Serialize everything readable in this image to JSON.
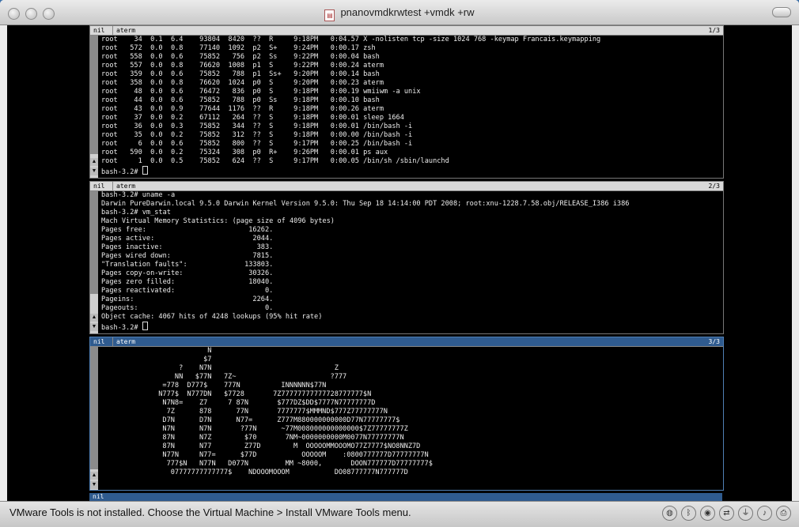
{
  "window": {
    "title": "pnanovmdkrwtest +vmdk +rw"
  },
  "panes": [
    {
      "tab1": "nil",
      "tab2": "aterm",
      "index": "1/3",
      "lines": [
        "root    34  0.1  6.4    93804  8420  ??  R     9:18PM   0:04.57 X -nolisten tcp -size 1024 768 -keymap Francais.keymapping",
        "root   572  0.0  0.8    77140  1092  p2  S+    9:24PM   0:00.17 zsh",
        "root   558  0.0  0.6    75852   756  p2  Ss    9:22PM   0:00.04 bash",
        "root   557  0.0  0.8    76620  1008  p1  S     9:22PM   0:00.24 aterm",
        "root   359  0.0  0.6    75852   788  p1  Ss+   9:20PM   0:00.14 bash",
        "root   358  0.0  0.8    76620  1024  p0  S     9:20PM   0:00.23 aterm",
        "root    48  0.0  0.6    76472   836  p0  S     9:18PM   0:00.19 wmiiwm -a unix",
        "root    44  0.0  0.6    75852   788  p0  Ss    9:18PM   0:00.10 bash",
        "root    43  0.0  0.9    77644  1176  ??  R     9:18PM   0:00.26 aterm",
        "root    37  0.0  0.2    67112   264  ??  S     9:18PM   0:00.01 sleep 1664",
        "root    36  0.0  0.3    75852   344  ??  S     9:18PM   0:00.01 /bin/bash -i",
        "root    35  0.0  0.2    75852   312  ??  S     9:18PM   0:00.00 /bin/bash -i",
        "root     6  0.0  0.6    75852   800  ??  S     9:17PM   0:00.25 /bin/bash -i",
        "root   590  0.0  0.2    75324   308  p0  R+    9:26PM   0:00.01 ps aux",
        "root     1  0.0  0.5    75852   624  ??  S     9:17PM   0:00.05 /bin/sh /sbin/launchd"
      ],
      "prompt": "bash-3.2# "
    },
    {
      "tab1": "nil",
      "tab2": "aterm",
      "index": "2/3",
      "lines": [
        "bash-3.2# uname -a",
        "Darwin PureDarwin.local 9.5.0 Darwin Kernel Version 9.5.0: Thu Sep 18 14:14:00 PDT 2008; root:xnu-1228.7.58.obj/RELEASE_I386 i386",
        "bash-3.2# vm_stat",
        "Mach Virtual Memory Statistics: (page size of 4096 bytes)",
        "Pages free:                         16262.",
        "Pages active:                        2044.",
        "Pages inactive:                       383.",
        "Pages wired down:                    7815.",
        "\"Translation faults\":              133803.",
        "Pages copy-on-write:                30326.",
        "Pages zero filled:                  18040.",
        "Pages reactivated:                      0.",
        "Pageins:                             2264.",
        "Pageouts:                               0.",
        "Object cache: 4067 hits of 4248 lookups (95% hit rate)"
      ],
      "prompt": "bash-3.2# "
    },
    {
      "tab1": "nil",
      "tab2": "aterm",
      "index": "3/3",
      "art": [
        "                   N",
        "                  $7",
        "            ?    N7N                              Z",
        "           NN   $77N   7Z~                       ?777",
        "        =778  D777$    777N          INNNNNN$77N",
        "       N777$  N777DN   $7728       7Z77777777777728777777$N",
        "        N7N8=    Z7     7 87N       $777DZ$DD$7777N77777777D",
        "         7Z      878      77N       7777777$MMMND$777Z77777777N",
        "        D7N      D7N      N77=      Z777M880000000000D77N77777777$",
        "        N7N      N7N       ?77N      ~77M008000000000000$7Z77777777Z",
        "        87N      N7Z        $70       7NM~0000000000M0077N77777777N",
        "        87N      N77        Z77D        M  OOOOOMMOOOMO77Z7777$NO8NNZ7D",
        "        N77N     N77=      $77D           OOOOOM    :0800777777D77777777N",
        "         777$N   N77N   D077N         MM ~8000,       DOON777777D77777777$",
        "          07777777777777$    NDOOOMOOOM           DO08777777N777777D"
      ]
    }
  ],
  "bottom_status": "nil",
  "vmware_status": {
    "message": "VMware Tools is not installed. Choose the Virtual Machine > Install VMware Tools menu."
  }
}
